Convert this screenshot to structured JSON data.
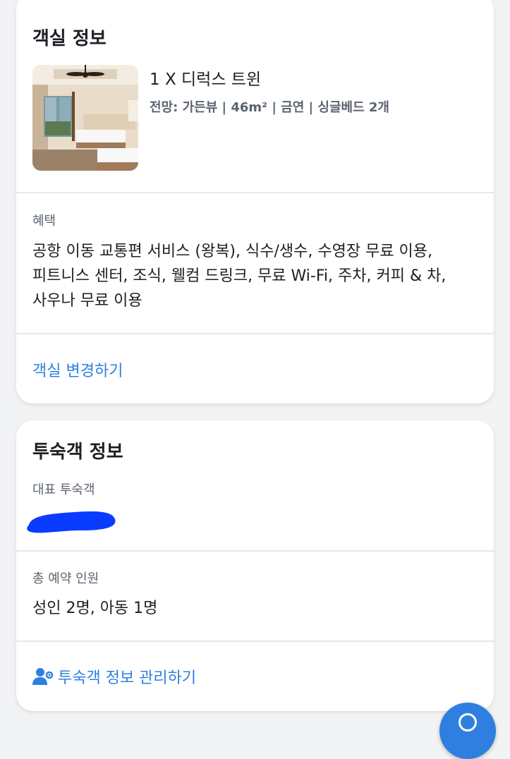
{
  "room_info": {
    "title": "객실 정보",
    "room_name": "1 X 디럭스 트윈",
    "room_details": "전망: 가든뷰 | 46m² | 금연 | 싱글베드 2개",
    "benefits_label": "혜택",
    "benefits_lines": [
      "공항 이동 교통편 서비스 (왕복), 식수/생수, 수영장 무료 이용,",
      "피트니스 센터, 조식, 웰컴 드링크, 무료 Wi-Fi, 주차, 커피 & 차,",
      "사우나 무료 이용"
    ],
    "change_room_label": "객실 변경하기"
  },
  "guest_info": {
    "title": "투숙객 정보",
    "lead_guest_label": "대표 투숙객",
    "total_guests_label": "총 예약 인원",
    "total_guests_value": "성인 2명, 아동 1명",
    "manage_label": "투숙객 정보 관리하기"
  },
  "colors": {
    "accent": "#2f7fe0",
    "redaction": "#0a3cff",
    "text_primary": "#1c1f24",
    "text_secondary": "#5b6470"
  },
  "icons": {
    "manage": "user-gear-icon",
    "fab": "chat-icon"
  }
}
